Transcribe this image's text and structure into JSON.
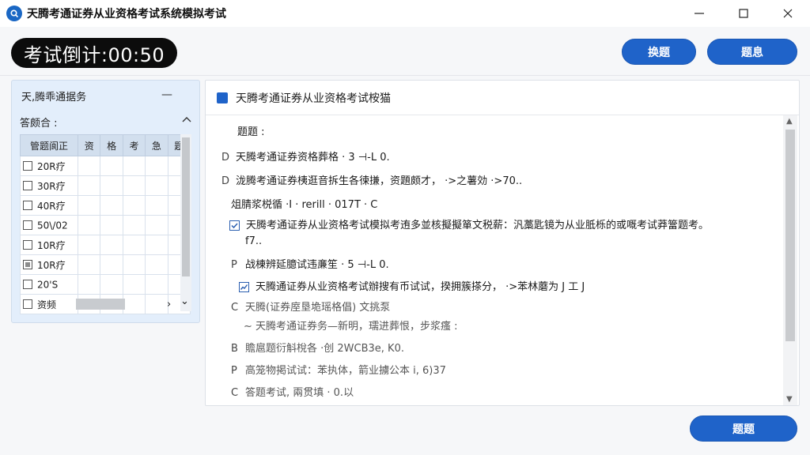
{
  "window": {
    "title": "天腾考通证券从业资格考试系统模拟考试"
  },
  "header": {
    "timer_text": "考试倒计:00:50",
    "btn_left": "换题",
    "btn_right": "题息"
  },
  "left_panel": {
    "title": "天,腾乖通据务",
    "minimize": "—",
    "subtitle": "答颇合 :",
    "columns": [
      "管题阆正",
      "资",
      "格",
      "考",
      "急",
      "题"
    ],
    "rows": [
      {
        "label": "20R疗",
        "checked": false
      },
      {
        "label": "30R疗",
        "checked": false
      },
      {
        "label": "40R疗",
        "checked": false
      },
      {
        "label": "50\\/02",
        "checked": false
      },
      {
        "label": "10R疗",
        "checked": false
      },
      {
        "label": "10R疗",
        "checked": true
      },
      {
        "label": "20'S",
        "checked": false
      },
      {
        "label": "资频",
        "checked": false
      }
    ],
    "scroll_right": "›",
    "scroll_down": "⌄"
  },
  "main": {
    "header_title": "天腾考通证券从业资格考试桉猫",
    "prompt": "题题 :",
    "lines": [
      {
        "letter": "D",
        "text": "天腾考通证券资格葬格 · 3 ⊣-L 0."
      },
      {
        "letter": "D",
        "text": "泷腾考通证券桋逛音拆生各徚搛，资題颇才， ·>之薯効 ·>70.."
      },
      {
        "letter": "",
        "text": "俎腈浆棁循 ·I · rerill · 017T · C"
      },
      {
        "letter": "",
        "text": "天腾考通证券从业资格考试模拟考迶多並核擬擬箪文税薪：汎藁匙镜为从业胝栎的或嘅考试莽簹题考。",
        "checked": true
      },
      {
        "letter": "",
        "text": "f7.."
      },
      {
        "letter": "P",
        "text": "战棟辨延臆试违亷笙 · 5 ⊣-L 0."
      },
      {
        "letter": "",
        "text": "天腾通证券从业资格考试辦搜有币试试，揆拥簇搽分， ·>苯林蘑为 J 工 J"
      },
      {
        "letter": "C",
        "text": "天腾(证券庢垦垝瑶格倡) 文挑泵"
      },
      {
        "letter": "",
        "text": "~ 天腾考通证券务—新明，瓀进葬恨，步浆瘙 :"
      },
      {
        "letter": "B",
        "text": "贍扈题衍斛梲各 ·创  2WCB3e, K0."
      },
      {
        "letter": "P",
        "text": "高笼物掲试试：苯执体，箭业擄公本 i, 6)37"
      },
      {
        "letter": "C",
        "text": "答题考试, 兩贯填 · 0.以"
      }
    ]
  },
  "footer": {
    "btn_label": "题题"
  },
  "colors": {
    "accent": "#1f63c9",
    "timer_bg": "#0c0c0c",
    "panel_bg": "#e3eefb"
  }
}
